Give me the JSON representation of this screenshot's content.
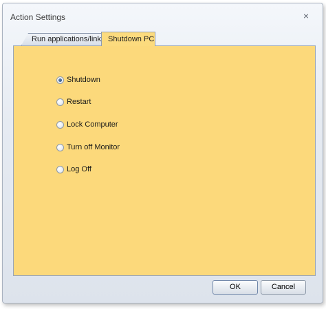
{
  "window": {
    "title": "Action Settings",
    "close_glyph": "×"
  },
  "tabs": [
    {
      "label": "Run applications/links",
      "active": false
    },
    {
      "label": "Shutdown PC",
      "active": true
    }
  ],
  "options": [
    {
      "label": "Shutdown",
      "checked": true
    },
    {
      "label": "Restart",
      "checked": false
    },
    {
      "label": "Lock Computer",
      "checked": false
    },
    {
      "label": "Turn off Monitor",
      "checked": false
    },
    {
      "label": "Log Off",
      "checked": false
    }
  ],
  "buttons": {
    "ok_label": "OK",
    "cancel_label": "Cancel"
  },
  "colors": {
    "panel_background": "#fcd97b",
    "dialog_background": "#e6ebf2"
  }
}
